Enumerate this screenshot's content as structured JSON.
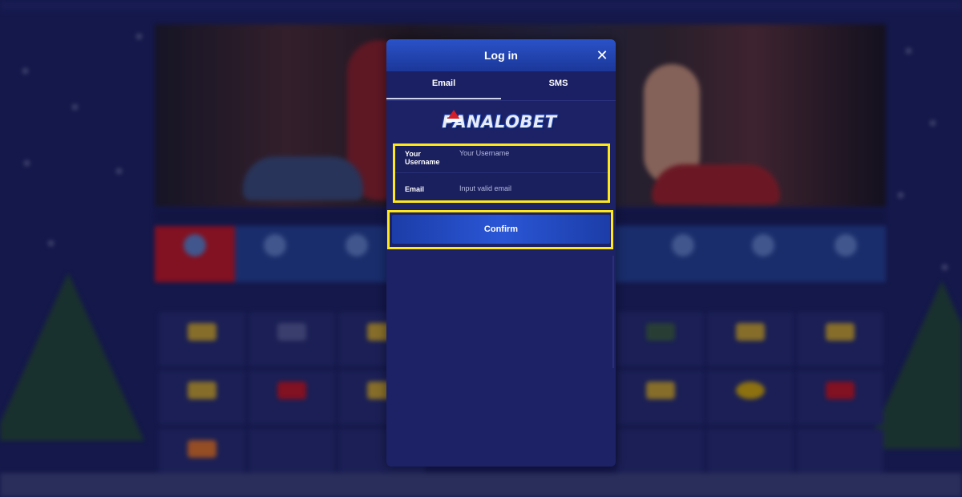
{
  "modal": {
    "title": "Log in",
    "close_icon": "close-icon",
    "tabs": [
      {
        "label": "Email",
        "active": true
      },
      {
        "label": "SMS",
        "active": false
      }
    ],
    "brand": "PANALOBET",
    "fields": {
      "username": {
        "label": "Your Username",
        "placeholder": "Your Username",
        "value": ""
      },
      "email": {
        "label": "Email",
        "placeholder": "Input valid email",
        "value": ""
      }
    },
    "confirm_label": "Confirm"
  },
  "colors": {
    "modal_bg": "#1d2266",
    "header_accent": "#2a52c8",
    "highlight": "#ffe81a",
    "page_bg": "#1b1f5a"
  }
}
